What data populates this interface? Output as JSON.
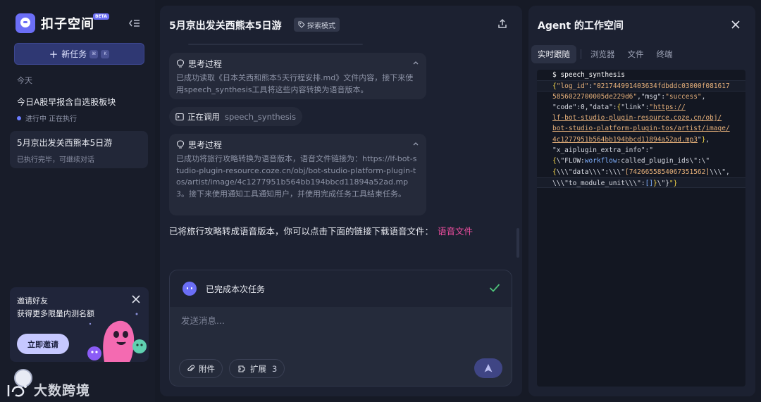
{
  "sidebar": {
    "brand_name": "扣子空间",
    "beta": "BETA",
    "new_task_label": "新任务",
    "shortcut_keys": [
      "⌘",
      "K"
    ],
    "section_today": "今天",
    "tasks": [
      {
        "title": "今日A股早报含自选股板块",
        "status": "进行中 正在执行"
      },
      {
        "title": "5月京出发关西熊本5日游",
        "status": "已执行完毕，可继续对话"
      }
    ],
    "invite": {
      "title": "邀请好友",
      "subtitle": "获得更多限量内测名额",
      "button": "立即邀请"
    },
    "watermark": "大数跨境"
  },
  "chat": {
    "title": "5月京出发关西熊本5日游",
    "mode_tag": "探索模式",
    "thinking": [
      {
        "label": "思考过程",
        "text": "已成功读取《日本关西和熊本5天行程安排.md》文件内容，接下来使用speech_synthesis工具将这些内容转换为语音版本。"
      },
      {
        "label": "思考过程",
        "text": "已成功将旅行攻略转换为语音版本，语音文件链接为：https://lf-bot-studio-plugin-resource.coze.cn/obj/bot-studio-platform-plugin-tos/artist/image/4c1277951b564bb194bbcd11894a52ad.mp3。接下来使用通知工具通知用户，并使用完成任务工具结束任务。"
      }
    ],
    "calling": {
      "label": "正在调用",
      "tool": "speech_synthesis"
    },
    "answer": {
      "text": "已将旅行攻略转成语音版本，你可以点击下面的链接下载语音文件：",
      "link": "语音文件"
    },
    "composer": {
      "done_label": "已完成本次任务",
      "placeholder": "发送消息...",
      "attach_label": "附件",
      "expand_label": "扩展",
      "expand_count": "3"
    }
  },
  "agent": {
    "title": "Agent 的工作空间",
    "tabs": [
      "实时跟随",
      "浏览器",
      "文件",
      "终端"
    ],
    "terminal": {
      "command": "$ speech_synthesis",
      "lines": [
        {
          "parts": [
            [
              "t-brace",
              "{"
            ],
            [
              "t-str",
              "\"log_id\""
            ],
            [
              "t-plain",
              ":"
            ],
            [
              "t-str",
              "\"021744991403634fdbddc03000f081617"
            ]
          ],
          "hl": true
        },
        {
          "parts": [
            [
              "t-str",
              "5856022700005de229d6\""
            ],
            [
              "t-plain",
              ",\"msg\":"
            ],
            [
              "t-str",
              "\"success\""
            ],
            [
              "t-plain",
              ","
            ]
          ],
          "hl": false
        },
        {
          "parts": [
            [
              "t-plain",
              "\"code\":0,\"data\":"
            ],
            [
              "t-brace",
              "{"
            ],
            [
              "t-plain",
              "\"link\":"
            ],
            [
              "t-link",
              "\"https://"
            ]
          ],
          "hl": false
        },
        {
          "parts": [
            [
              "t-link",
              "lf-bot-studio-plugin-resource.coze.cn/obj/"
            ]
          ],
          "hl": false
        },
        {
          "parts": [
            [
              "t-link",
              "bot-studio-platform-plugin-tos/artist/image/"
            ]
          ],
          "hl": false
        },
        {
          "parts": [
            [
              "t-link",
              "4c1277951b564bb194bbcd11894a52ad.mp3"
            ],
            [
              "t-plain",
              "\""
            ],
            [
              "t-brace",
              "}"
            ],
            [
              "t-plain",
              ","
            ]
          ],
          "hl": false
        },
        {
          "parts": [
            [
              "t-plain",
              "\"x_aiplugin_extra_info\":\""
            ]
          ],
          "hl": false
        },
        {
          "parts": [
            [
              "t-brace",
              "{"
            ],
            [
              "t-plain",
              "\\\"FLOW:"
            ],
            [
              "t-blue",
              "workflow"
            ],
            [
              "t-plain",
              ":called_plugin_ids\\\":\\\""
            ]
          ],
          "hl": false
        },
        {
          "parts": [
            [
              "t-brace",
              "{"
            ],
            [
              "t-plain",
              "\\\\\\\"data\\\\\\\":\\\\\\\""
            ],
            [
              "t-str",
              "[7426655854067351562]"
            ],
            [
              "t-plain",
              "\\\\\\\","
            ]
          ],
          "hl": false
        },
        {
          "parts": [
            [
              "t-plain",
              "\\\\\\\"to_module_unit\\\\\\\":"
            ],
            [
              "t-blue",
              "[]"
            ],
            [
              "t-brace",
              "}"
            ],
            [
              "t-plain",
              "\\\"}"
            ],
            [
              "t-brace",
              "\"}"
            ]
          ],
          "hl": true
        }
      ]
    }
  },
  "colors": {
    "accent": "#6b6ef6",
    "link_pink": "#ef4ea0",
    "success_green": "#4fc37a",
    "panel_bg": "#1c2131"
  }
}
